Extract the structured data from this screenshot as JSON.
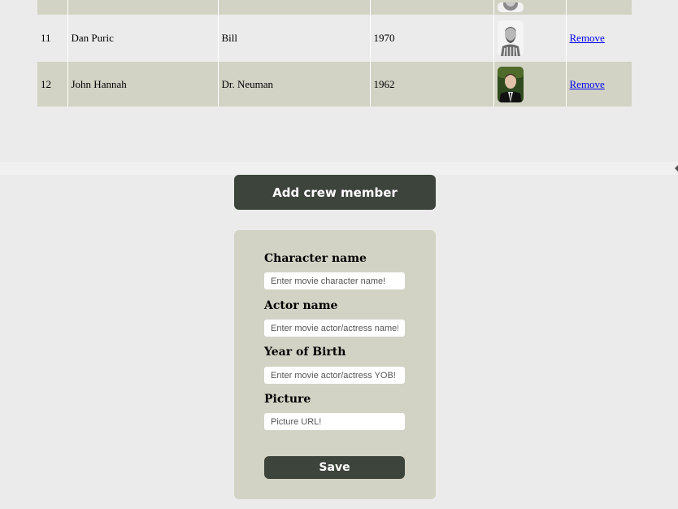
{
  "crew_table": {
    "rows": [
      {
        "id": "",
        "actor": "",
        "character": "",
        "year": "",
        "remove_label": ""
      },
      {
        "id": "11",
        "actor": "Dan Puric",
        "character": "Bill",
        "year": "1970",
        "remove_label": "Remove"
      },
      {
        "id": "12",
        "actor": "John Hannah",
        "character": "Dr. Neuman",
        "year": "1962",
        "remove_label": "Remove"
      }
    ]
  },
  "add_button_label": "Add crew member",
  "form": {
    "character_label": "Character name",
    "character_placeholder": "Enter movie character name!",
    "actor_label": "Actor name",
    "actor_placeholder": "Enter movie actor/actress name!",
    "yob_label": "Year of Birth",
    "yob_placeholder": "Enter movie actor/actress YOB!",
    "picture_label": "Picture",
    "picture_placeholder": "Picture URL!",
    "save_label": "Save"
  },
  "colors": {
    "row_alt": "#d2d3c5",
    "button_dark": "#3d443c",
    "background": "#ebebeb"
  }
}
